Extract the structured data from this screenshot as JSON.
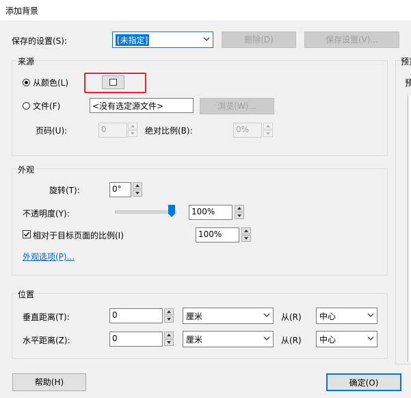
{
  "window": {
    "title": "添加背景"
  },
  "saved_settings": {
    "label": "保存的设置(S):",
    "value": "[未指定]",
    "delete_label": "删除(D)",
    "save_label": "保存设置(V)..."
  },
  "source": {
    "title": "来源",
    "from_color_label": "从颜色(L)",
    "file_label": "文件(F)",
    "file_value": "<没有选定源文件>",
    "browse_label": "浏览(W)...",
    "page_label": "页码(U):",
    "page_value": "0",
    "abs_scale_label": "绝对比例(B):",
    "abs_scale_value": "0%",
    "selected_color": "#ffffff",
    "highlight_color": "#e8232a"
  },
  "appearance": {
    "title": "外观",
    "rotation_label": "旋转(T):",
    "rotation_value": "0°",
    "opacity_label": "不透明度(Y):",
    "opacity_value": "100%",
    "opacity_fraction": 1.0,
    "relative_scale_label": "相对于目标页面的比例(I)",
    "relative_scale_value": "100%",
    "relative_scale_checked": true,
    "options_link": "外观选项(P)..."
  },
  "position": {
    "title": "位置",
    "vertical_label": "垂直距离(T):",
    "vertical_value": "0",
    "vertical_unit": "厘米",
    "vertical_from_label": "从(R)",
    "vertical_from": "中心",
    "horizontal_label": "水平距离(Z):",
    "horizontal_value": "0",
    "horizontal_unit": "厘米",
    "horizontal_from_label": "从(R)",
    "horizontal_from": "中心"
  },
  "preview": {
    "title": "预览",
    "sub": "预"
  },
  "footer": {
    "help_label": "帮助(H)",
    "ok_label": "确定(O)"
  }
}
